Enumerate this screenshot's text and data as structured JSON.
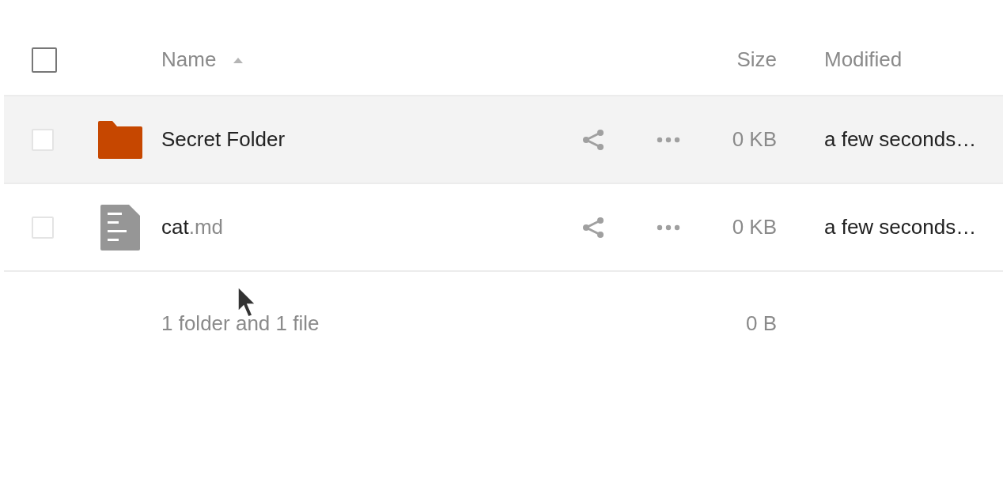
{
  "header": {
    "checked": false,
    "columns": [
      "Name",
      "Size",
      "Modified"
    ]
  },
  "files": [
    {
      "kind": "folder",
      "name": "Secret Folder",
      "size": "0 KB",
      "modified": "a few seconds…",
      "checked": false,
      "highlighted": true
    },
    {
      "kind": "document",
      "name": "cat",
      "extension": ".md",
      "size": "0 KB",
      "modified": "a few seconds…",
      "checked": false,
      "highlighted": false
    }
  ],
  "summary": {
    "label": "1 folder and 1 file",
    "size": "0 B"
  }
}
